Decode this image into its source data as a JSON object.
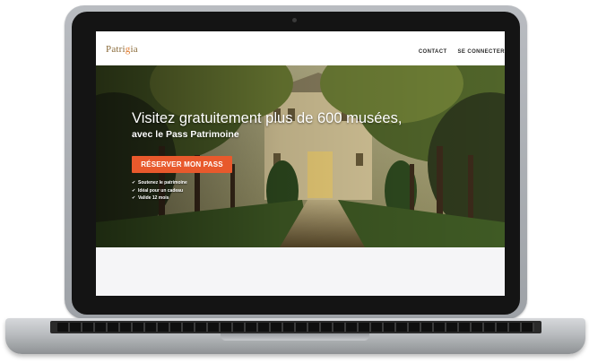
{
  "site": {
    "logo_start": "Patri",
    "logo_accent": "g",
    "logo_end": "ia",
    "nav": {
      "contact": "CONTACT",
      "login": "SE CONNECTER"
    }
  },
  "hero": {
    "title": "Visitez gratuitement plus de 600 musées,",
    "subtitle": "avec le Pass Patrimoine",
    "cta_label": "RÉSERVER MON PASS",
    "check_icon": "✔",
    "features": [
      "Soutenez le patrimoine",
      "Idéal pour un cadeau",
      "Valide 12 mois"
    ]
  },
  "colors": {
    "cta": "#e8592c",
    "logo": "#8a6b3a",
    "logo_accent": "#e07a2e",
    "content_background": "#f5f5f7"
  }
}
